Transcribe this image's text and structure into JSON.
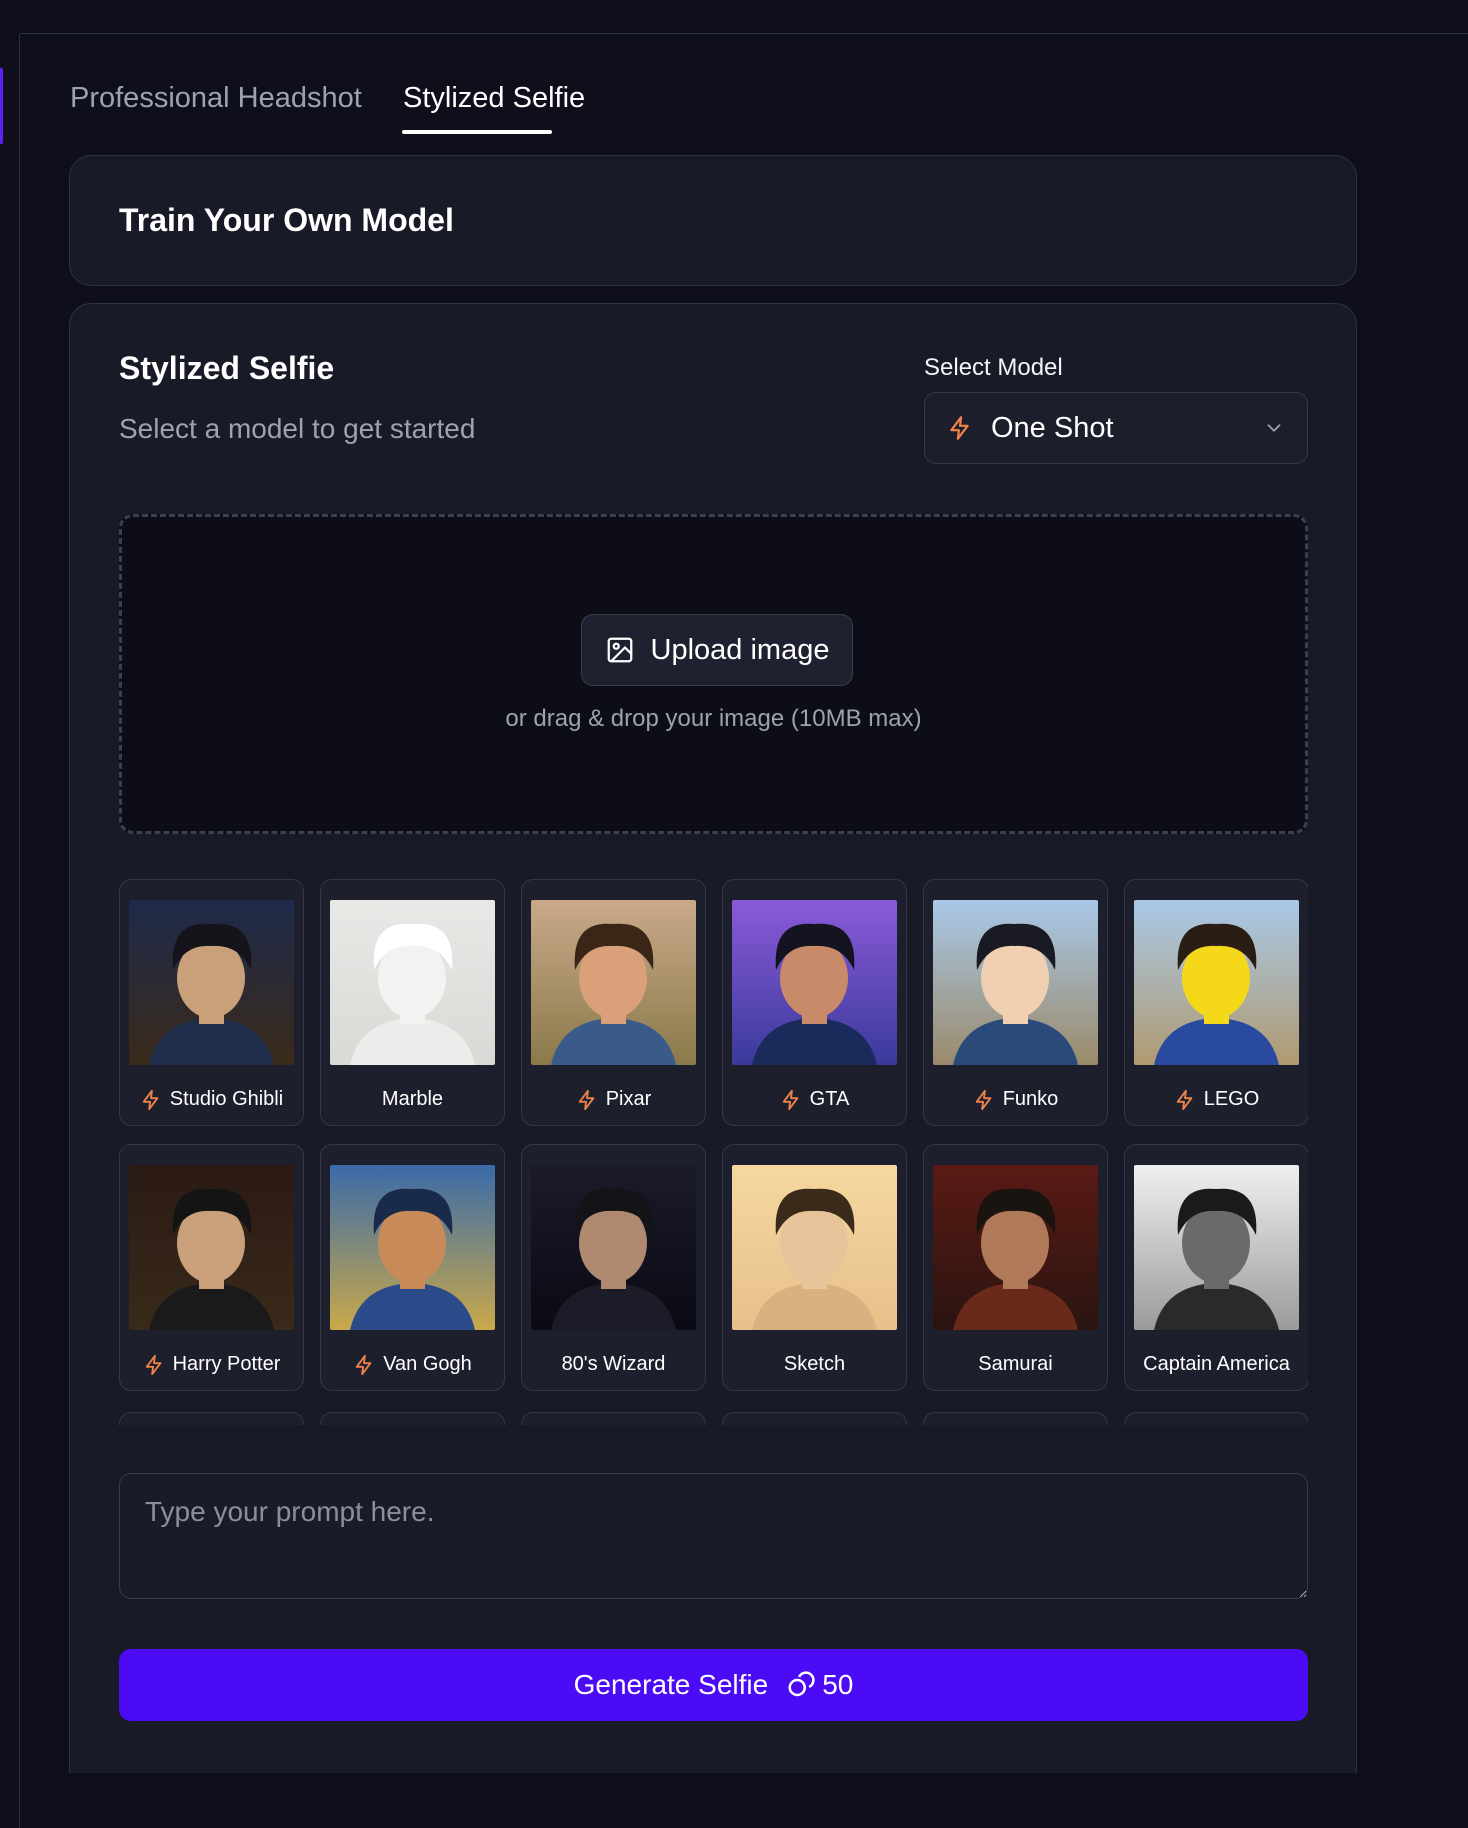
{
  "tabs": [
    {
      "label": "Professional Headshot",
      "active": false
    },
    {
      "label": "Stylized Selfie",
      "active": true
    }
  ],
  "train": {
    "title": "Train Your Own Model"
  },
  "selfie": {
    "title": "Stylized Selfie",
    "subtitle": "Select a model to get started"
  },
  "model_select": {
    "label": "Select Model",
    "value": "One Shot",
    "icon": "bolt-icon"
  },
  "upload": {
    "button_label": "Upload image",
    "hint": "or drag & drop your image (10MB max)",
    "icon": "image-icon"
  },
  "styles": [
    {
      "label": "Studio Ghibli",
      "bolt": true
    },
    {
      "label": "Marble",
      "bolt": false
    },
    {
      "label": "Pixar",
      "bolt": true
    },
    {
      "label": "GTA",
      "bolt": true
    },
    {
      "label": "Funko",
      "bolt": true
    },
    {
      "label": "LEGO",
      "bolt": true
    },
    {
      "label": "Harry Potter",
      "bolt": true
    },
    {
      "label": "Van Gogh",
      "bolt": true
    },
    {
      "label": "80's Wizard",
      "bolt": false
    },
    {
      "label": "Sketch",
      "bolt": false
    },
    {
      "label": "Samurai",
      "bolt": false
    },
    {
      "label": "Captain America",
      "bolt": false
    }
  ],
  "prompt": {
    "placeholder": "Type your prompt here.",
    "value": ""
  },
  "generate": {
    "label": "Generate Selfie",
    "cost": "50",
    "icon": "coins-icon"
  },
  "colors": {
    "accent": "#4c0bf5",
    "bolt": "#f0824a",
    "background": "#0e0f1a",
    "card": "#191a27"
  }
}
